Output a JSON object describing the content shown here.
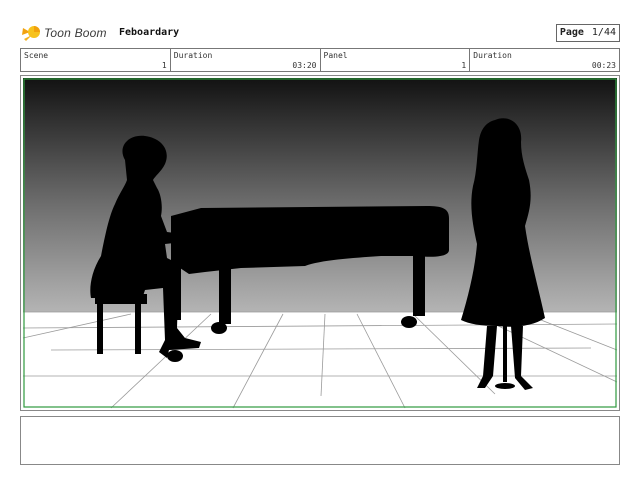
{
  "header": {
    "brand": "Toon Boom",
    "project_name": "Feboardary",
    "page_label": "Page",
    "page_value": "1/44"
  },
  "info": {
    "scene_label": "Scene",
    "scene_value": "1",
    "scene_duration_label": "Duration",
    "scene_duration_value": "03:20",
    "panel_label": "Panel",
    "panel_value": "1",
    "panel_duration_label": "Duration",
    "panel_duration_value": "00:23"
  },
  "panel": {
    "frame_color": "#2e9a3e",
    "icons": [
      "toon-boom-logo"
    ]
  },
  "notes": {
    "text": ""
  }
}
